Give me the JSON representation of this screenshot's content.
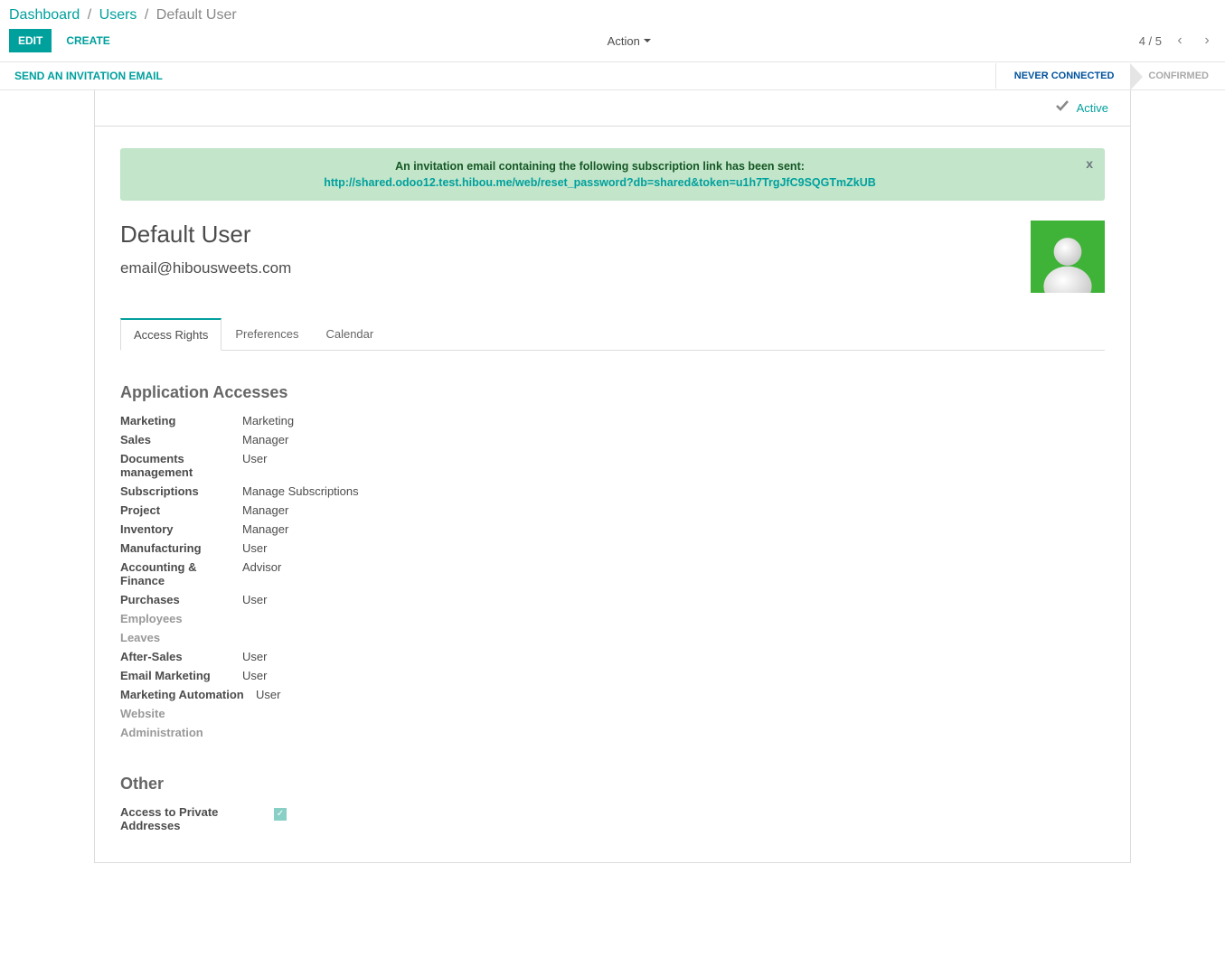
{
  "breadcrumb": {
    "dashboard": "Dashboard",
    "users": "Users",
    "current": "Default User"
  },
  "toolbar": {
    "edit": "Edit",
    "create": "Create",
    "action": "Action"
  },
  "pager": {
    "text": "4 / 5"
  },
  "statusbar": {
    "send_invite": "Send an Invitation Email",
    "step_never": "Never Connected",
    "step_confirmed": "Confirmed"
  },
  "active_badge": "Active",
  "alert": {
    "text": "An invitation email containing the following subscription link has been sent:",
    "link": "http://shared.odoo12.test.hibou.me/web/reset_password?db=shared&token=u1h7TrgJfC9SQGTmZkUB",
    "close": "x"
  },
  "user": {
    "name": "Default User",
    "email": "email@hibousweets.com"
  },
  "tabs": {
    "access_rights": "Access Rights",
    "preferences": "Preferences",
    "calendar": "Calendar"
  },
  "sections": {
    "app_accesses": "Application Accesses",
    "other": "Other"
  },
  "access": {
    "marketing_l": "Marketing",
    "marketing_v": "Marketing",
    "sales_l": "Sales",
    "sales_v": "Manager",
    "documents_l": "Documents management",
    "documents_v": "User",
    "subs_l": "Subscriptions",
    "subs_v": "Manage Subscriptions",
    "project_l": "Project",
    "project_v": "Manager",
    "inventory_l": "Inventory",
    "inventory_v": "Manager",
    "manufacturing_l": "Manufacturing",
    "manufacturing_v": "User",
    "accounting_l": "Accounting & Finance",
    "accounting_v": "Advisor",
    "purchases_l": "Purchases",
    "purchases_v": "User",
    "employees_l": "Employees",
    "leaves_l": "Leaves",
    "aftersales_l": "After-Sales",
    "aftersales_v": "User",
    "emailmkt_l": "Email Marketing",
    "emailmkt_v": "User",
    "mktauto_l": "Marketing Automation",
    "mktauto_v": "User",
    "website_l": "Website",
    "admin_l": "Administration"
  },
  "other": {
    "private_addresses_l": "Access to Private Addresses"
  }
}
